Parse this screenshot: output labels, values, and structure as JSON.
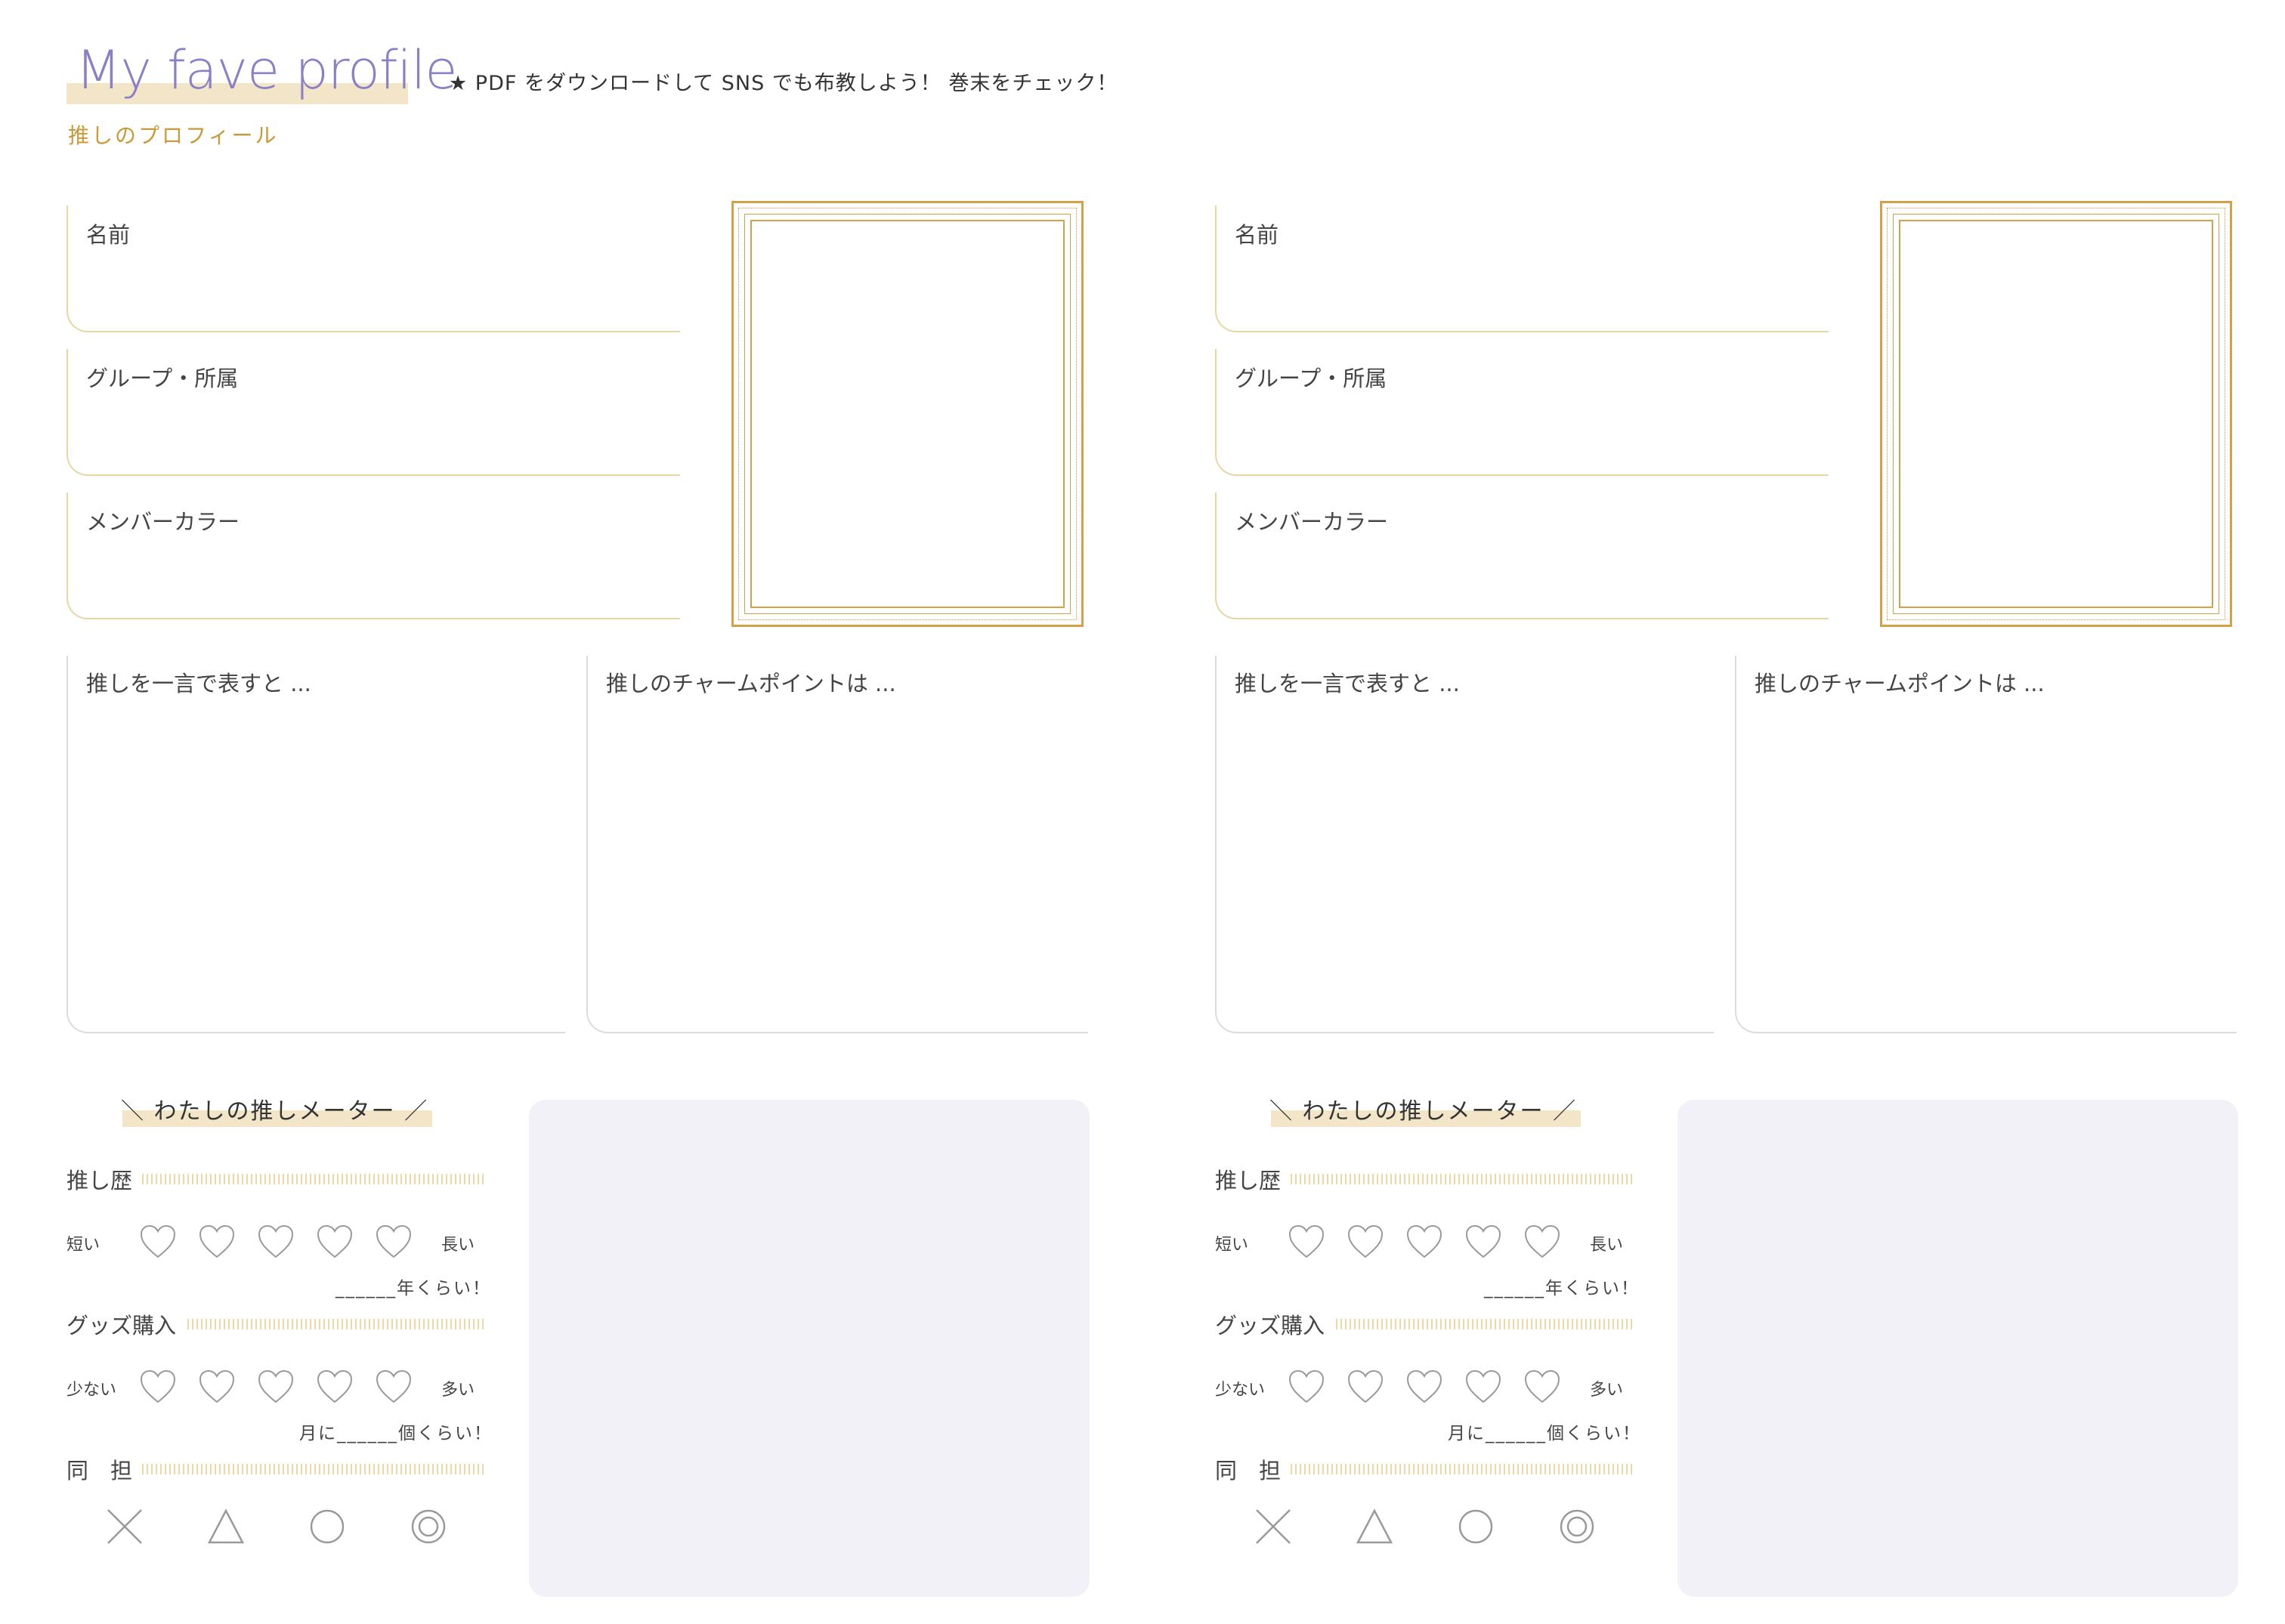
{
  "header": {
    "title": "My fave profile",
    "subtitle": "推しのプロフィール",
    "notice": "★ PDF をダウンロードして SNS でも布教しよう！ 巻末をチェック！"
  },
  "profiles": [
    {
      "fields": {
        "name": "名前",
        "group": "グループ・所属",
        "member_color": "メンバーカラー"
      },
      "boxes": {
        "one_word": "推しを一言で表すと ...",
        "charm_point": "推しのチャームポイントは ..."
      },
      "meter": {
        "title": "＼ わたしの推しメーター ／",
        "history": {
          "label": "推し歴",
          "low": "短い",
          "high": "長い",
          "note": "______年くらい！"
        },
        "goods": {
          "label": "グッズ購入",
          "low": "少ない",
          "high": "多い",
          "note": "月に______個くらい！"
        },
        "same_tan": {
          "label": "同　担"
        }
      }
    },
    {
      "fields": {
        "name": "名前",
        "group": "グループ・所属",
        "member_color": "メンバーカラー"
      },
      "boxes": {
        "one_word": "推しを一言で表すと ...",
        "charm_point": "推しのチャームポイントは ..."
      },
      "meter": {
        "title": "＼ わたしの推しメーター ／",
        "history": {
          "label": "推し歴",
          "low": "短い",
          "high": "長い",
          "note": "______年くらい！"
        },
        "goods": {
          "label": "グッズ購入",
          "low": "少ない",
          "high": "多い",
          "note": "月に______個くらい！"
        },
        "same_tan": {
          "label": "同　担"
        }
      }
    }
  ],
  "colors": {
    "title": "#8a80c8",
    "accent_gold": "#d4a04a",
    "highlight": "#f3e6c8",
    "gray_box": "#f1f1f7"
  }
}
